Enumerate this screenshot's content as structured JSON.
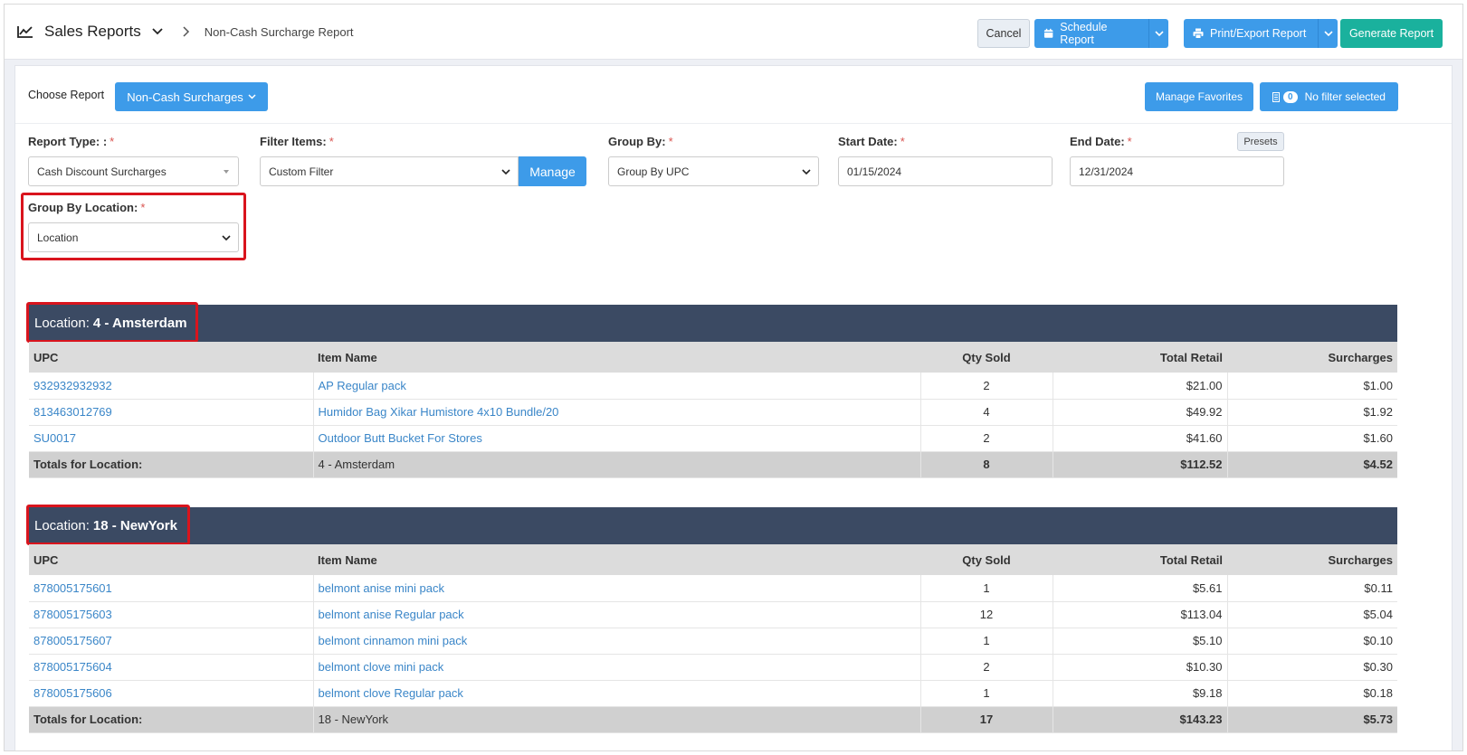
{
  "header": {
    "module_title": "Sales Reports",
    "breadcrumb": "Non-Cash Surcharge Report",
    "cancel_label": "Cancel",
    "schedule_label": "Schedule Report",
    "print_label": "Print/Export Report",
    "generate_label": "Generate Report"
  },
  "toolbar": {
    "choose_label": "Choose Report",
    "report_selected": "Non-Cash Surcharges",
    "favorites_label": "Manage Favorites",
    "filter_count": "0",
    "filter_label": "No filter selected"
  },
  "form": {
    "report_type_label": "Report Type: :",
    "report_type_value": "Cash Discount Surcharges",
    "filter_items_label": "Filter Items:",
    "filter_items_value": "Custom Filter",
    "manage_label": "Manage",
    "group_by_label": "Group By:",
    "group_by_value": "Group By UPC",
    "start_date_label": "Start Date:",
    "start_date_value": "01/15/2024",
    "end_date_label": "End Date:",
    "end_date_value": "12/31/2024",
    "presets_label": "Presets",
    "group_loc_label": "Group By Location:",
    "group_loc_value": "Location",
    "required_mark": "*"
  },
  "columns": [
    "UPC",
    "Item Name",
    "Qty Sold",
    "Total Retail",
    "Surcharges"
  ],
  "locations": [
    {
      "prefix": "Location:",
      "name": "4 - Amsterdam",
      "rows": [
        [
          "932932932932",
          "AP Regular pack",
          "2",
          "$21.00",
          "$1.00"
        ],
        [
          "813463012769",
          "Humidor Bag Xikar Humistore 4x10 Bundle/20",
          "4",
          "$49.92",
          "$1.92"
        ],
        [
          "SU0017",
          "Outdoor Butt Bucket For Stores",
          "2",
          "$41.60",
          "$1.60"
        ]
      ],
      "totals": [
        "Totals for Location:",
        "4 - Amsterdam",
        "8",
        "$112.52",
        "$4.52"
      ]
    },
    {
      "prefix": "Location:",
      "name": "18 - NewYork",
      "rows": [
        [
          "878005175601",
          "belmont anise mini pack",
          "1",
          "$5.61",
          "$0.11"
        ],
        [
          "878005175603",
          "belmont anise Regular pack",
          "12",
          "$113.04",
          "$5.04"
        ],
        [
          "878005175607",
          "belmont cinnamon mini pack",
          "1",
          "$5.10",
          "$0.10"
        ],
        [
          "878005175604",
          "belmont clove mini pack",
          "2",
          "$10.30",
          "$0.30"
        ],
        [
          "878005175606",
          "belmont clove Regular pack",
          "1",
          "$9.18",
          "$0.18"
        ]
      ],
      "totals": [
        "Totals for Location:",
        "18 - NewYork",
        "17",
        "$143.23",
        "$5.73"
      ]
    }
  ],
  "colors": {
    "primary": "#3d9be9",
    "generate": "#1ab19d",
    "location_header": "#3b4a63",
    "link": "#3a86c8",
    "highlight": "#d9141d"
  }
}
